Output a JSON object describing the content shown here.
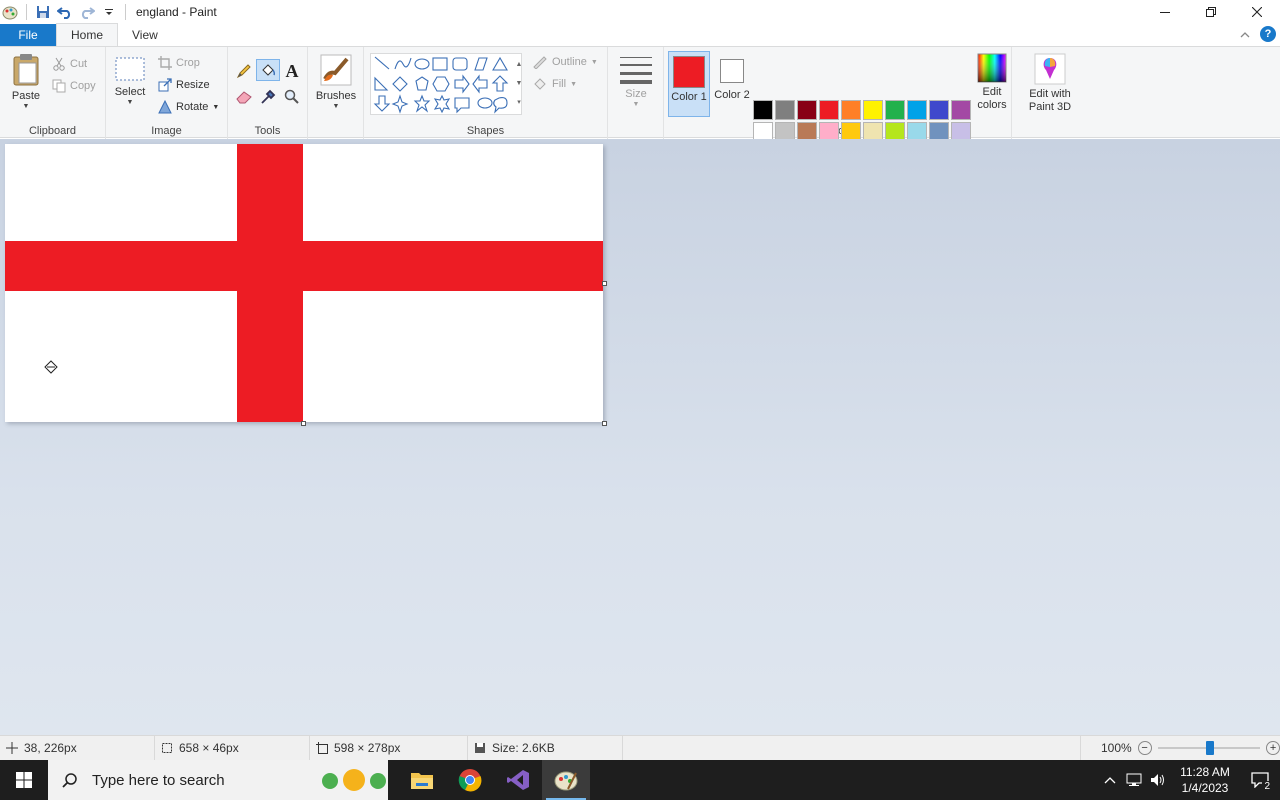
{
  "window": {
    "title": "england - Paint"
  },
  "tabs": {
    "file": "File",
    "home": "Home",
    "view": "View"
  },
  "clipboard": {
    "paste": "Paste",
    "cut": "Cut",
    "copy": "Copy",
    "group": "Clipboard"
  },
  "image": {
    "select": "Select",
    "crop": "Crop",
    "resize": "Resize",
    "rotate": "Rotate",
    "group": "Image"
  },
  "tools": {
    "group": "Tools"
  },
  "brushes": {
    "label": "Brushes"
  },
  "shapes": {
    "outline": "Outline",
    "fill": "Fill",
    "group": "Shapes"
  },
  "size": {
    "label": "Size"
  },
  "colors": {
    "color1": "Color 1",
    "color2": "Color 2",
    "edit": "Edit colors",
    "group": "Colors",
    "color1_value": "#ed1c24",
    "color2_value": "#ffffff",
    "palette": [
      "#000000",
      "#7f7f7f",
      "#880015",
      "#ed1c24",
      "#ff7f27",
      "#fff200",
      "#22b14c",
      "#00a2e8",
      "#3f48cc",
      "#a349a4",
      "#ffffff",
      "#c3c3c3",
      "#b97a57",
      "#ffaec9",
      "#ffc90e",
      "#efe4b0",
      "#b5e61d",
      "#99d9ea",
      "#7092be",
      "#c8bfe7",
      "#ffffff",
      "#ffffff",
      "#ffffff",
      "#ffffff",
      "#ffffff",
      "#ffffff",
      "#ffffff",
      "#ffffff",
      "#ffffff",
      "#ffffff"
    ]
  },
  "paint3d": {
    "label": "Edit with Paint 3D"
  },
  "canvas": {
    "flag_color": "#ed1c24"
  },
  "status": {
    "cursor": "38, 226px",
    "selection": "658 × 46px",
    "image_size": "598 × 278px",
    "file_size": "Size: 2.6KB",
    "zoom": "100%",
    "zoom_level": 0.5
  },
  "taskbar": {
    "search_placeholder": "Type here to search",
    "time": "11:28 AM",
    "date": "1/4/2023",
    "notifications": "2"
  }
}
